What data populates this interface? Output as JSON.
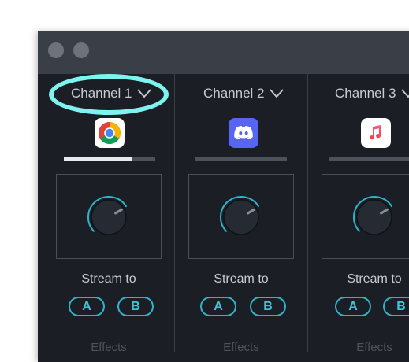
{
  "window": {
    "traffic_lights": [
      "close",
      "minimize"
    ]
  },
  "channels": [
    {
      "name": "Channel 1",
      "app_icon": "chrome-icon",
      "meter_level": 0.75,
      "knob_level": 0.72,
      "stream_label": "Stream to",
      "bus_a": "A",
      "bus_b": "B",
      "effects_label": "Effects",
      "highlighted": true
    },
    {
      "name": "Channel 2",
      "app_icon": "discord-icon",
      "meter_level": 0.0,
      "knob_level": 0.72,
      "stream_label": "Stream to",
      "bus_a": "A",
      "bus_b": "B",
      "effects_label": "Effects"
    },
    {
      "name": "Channel 3",
      "app_icon": "music-icon",
      "meter_level": 0.0,
      "knob_level": 0.72,
      "stream_label": "Stream to",
      "bus_a": "A",
      "bus_b": "B",
      "effects_label": "Effects"
    }
  ],
  "colors": {
    "accent": "#2fb3c9",
    "highlight": "#7ff3f0",
    "discord": "#5865f2",
    "music": "#fb5c74"
  }
}
